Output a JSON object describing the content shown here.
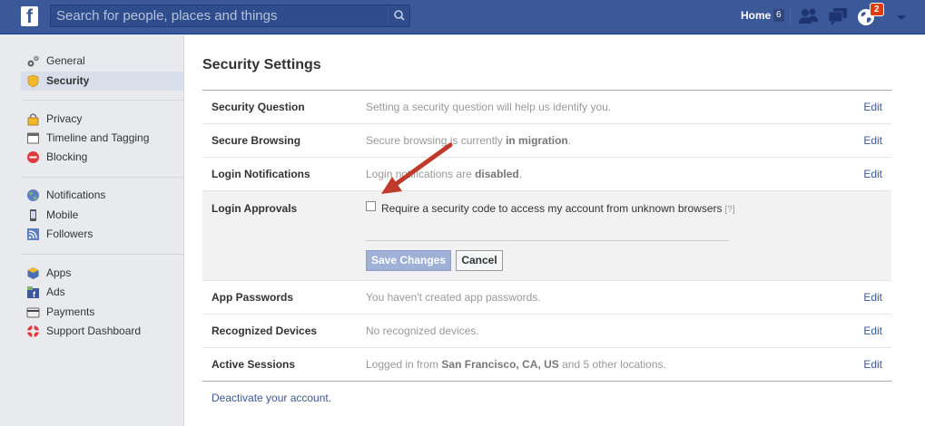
{
  "topbar": {
    "logo": "f",
    "search_placeholder": "Search for people, places and things",
    "home_label": "Home",
    "home_count": "6",
    "notifications_count": "2",
    "icons": [
      "facebook-logo",
      "search-icon",
      "friends-icon",
      "messages-icon",
      "notifications-globe-icon",
      "chevron-down-icon"
    ]
  },
  "sidebar": {
    "groups": [
      [
        {
          "label": "General",
          "icon": "gears-icon"
        },
        {
          "label": "Security",
          "icon": "shield-icon",
          "active": true
        }
      ],
      [
        {
          "label": "Privacy",
          "icon": "lock-icon"
        },
        {
          "label": "Timeline and Tagging",
          "icon": "timeline-icon"
        },
        {
          "label": "Blocking",
          "icon": "block-icon"
        }
      ],
      [
        {
          "label": "Notifications",
          "icon": "globe-icon"
        },
        {
          "label": "Mobile",
          "icon": "mobile-icon"
        },
        {
          "label": "Followers",
          "icon": "rss-icon"
        }
      ],
      [
        {
          "label": "Apps",
          "icon": "apps-icon"
        },
        {
          "label": "Ads",
          "icon": "ads-icon"
        },
        {
          "label": "Payments",
          "icon": "credit-card-icon"
        },
        {
          "label": "Support Dashboard",
          "icon": "lifebuoy-icon"
        }
      ]
    ]
  },
  "main": {
    "title": "Security Settings",
    "edit_label": "Edit",
    "rows": [
      {
        "label": "Security Question",
        "desc": "Setting a security question will help us identify you."
      },
      {
        "label": "Secure Browsing",
        "desc_pre": "Secure browsing is currently ",
        "desc_bold": "in migration",
        "desc_post": "."
      },
      {
        "label": "Login Notifications",
        "desc_pre": "Login notifications are ",
        "desc_bold": "disabled",
        "desc_post": "."
      }
    ],
    "login_approvals": {
      "label": "Login Approvals",
      "checkbox_label": "Require a security code to access my account from unknown browsers",
      "checked": false,
      "help": "[?]",
      "save_label": "Save Changes",
      "cancel_label": "Cancel"
    },
    "rows_after": [
      {
        "label": "App Passwords",
        "desc": "You haven't created app passwords."
      },
      {
        "label": "Recognized Devices",
        "desc": "No recognized devices."
      },
      {
        "label": "Active Sessions",
        "desc_pre": "Logged in from ",
        "desc_bold": "San Francisco, CA, US",
        "desc_post": " and 5 other locations."
      }
    ],
    "deactivate": "Deactivate your account."
  },
  "colors": {
    "brand": "#3b5998",
    "annotation_arrow": "#c0392b"
  }
}
